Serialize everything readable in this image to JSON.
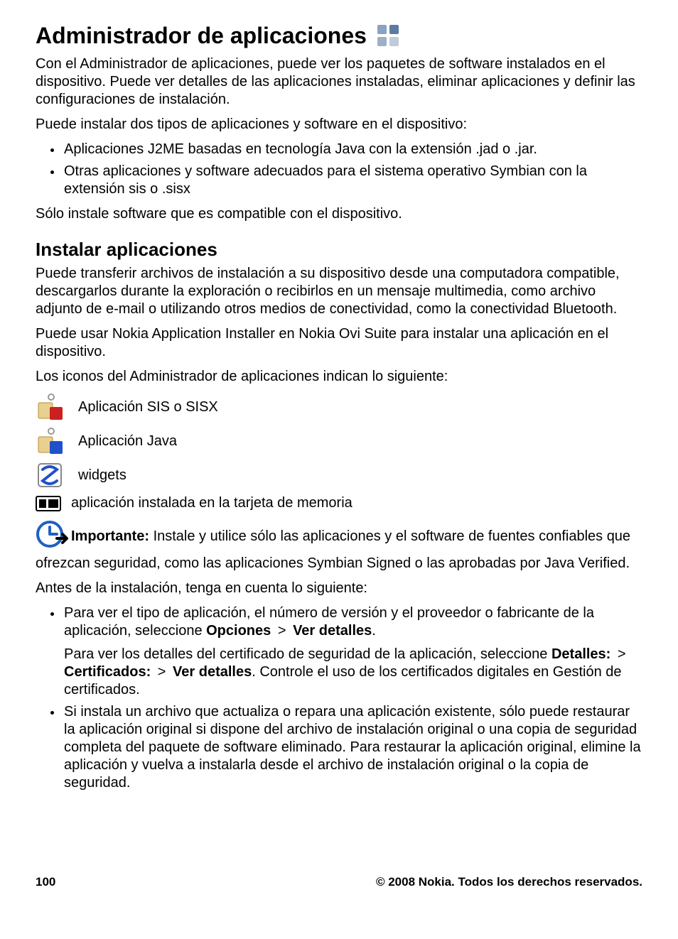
{
  "h1_title": "Administrador de aplicaciones",
  "p1": "Con el Administrador de aplicaciones, puede ver los paquetes de software instalados en el dispositivo. Puede ver detalles de las aplicaciones instaladas, eliminar aplicaciones y definir las configuraciones de instalación.",
  "p2": "Puede instalar dos tipos de aplicaciones y software en el dispositivo:",
  "list1": {
    "i0": "Aplicaciones J2ME basadas en tecnología Java con la extensión .jad o .jar.",
    "i1": "Otras aplicaciones y software adecuados para el sistema operativo Symbian con la extensión sis o .sisx"
  },
  "p3": "Sólo instale software que es compatible con el dispositivo.",
  "h2_title": "Instalar aplicaciones",
  "p4": "Puede transferir archivos de instalación a su dispositivo desde una computadora compatible, descargarlos durante la exploración o recibirlos en un mensaje multimedia, como archivo adjunto de e-mail o utilizando otros medios de conectividad, como la conectividad Bluetooth.",
  "p5": "Puede usar Nokia Application Installer en Nokia Ovi Suite para instalar una aplicación en el dispositivo.",
  "p6": "Los iconos del Administrador de aplicaciones indican lo siguiente:",
  "icons": {
    "sis": "Aplicación SIS o SISX",
    "java": "Aplicación Java",
    "widgets": "widgets",
    "mem": "aplicación instalada en la tarjeta de memoria"
  },
  "important_label": "Importante: ",
  "important_text": " Instale y utilice sólo las aplicaciones y el software de fuentes confiables que ofrezcan seguridad, como las aplicaciones Symbian Signed o las aprobadas por Java Verified.",
  "p7": "Antes de la instalación, tenga en cuenta lo siguiente:",
  "list2": {
    "i0_a": "Para ver el tipo de aplicación, el número de versión y el proveedor o fabricante de la aplicación, seleccione ",
    "i0_b1": "Opciones",
    "i0_gt1": " > ",
    "i0_b2": "Ver detalles",
    "i0_end": ".",
    "i0_p2a": "Para ver los detalles del certificado de seguridad de la aplicación, seleccione ",
    "i0_p2b1": "Detalles:",
    "i0_p2gt1": " > ",
    "i0_p2b2": "Certificados:",
    "i0_p2gt2": " > ",
    "i0_p2b3": "Ver detalles",
    "i0_p2end": ". Controle el uso de los certificados digitales en Gestión de certificados.",
    "i1": "Si instala un archivo que actualiza o repara una aplicación existente, sólo puede restaurar la aplicación original si dispone del archivo de instalación original o una copia de seguridad completa del paquete de software eliminado. Para restaurar la aplicación original, elimine la aplicación y vuelva a instalarla desde el archivo de instalación original o la copia de seguridad."
  },
  "footer": {
    "page": "100",
    "copyright": "© 2008 Nokia. Todos los derechos reservados."
  }
}
